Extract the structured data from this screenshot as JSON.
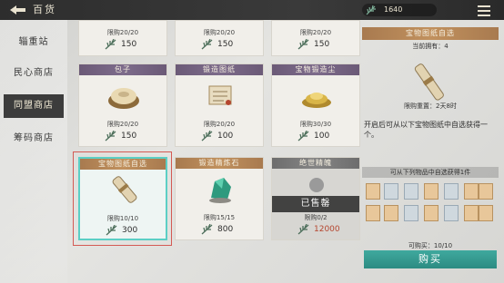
{
  "header": {
    "back_icon": "back-arrow-icon",
    "title": "百货",
    "currency_icon": "bamboo-leaf-icon",
    "currency_value": "1640",
    "menu_icon": "menu-icon"
  },
  "sidebar": {
    "items": [
      {
        "label": "辎重站",
        "active": false
      },
      {
        "label": "民心商店",
        "active": false
      },
      {
        "label": "同盟商店",
        "active": true
      },
      {
        "label": "筹码商店",
        "active": false
      }
    ]
  },
  "grid": {
    "row0": [
      {
        "limit": "限购20/20",
        "price": "150"
      },
      {
        "limit": "限购20/20",
        "price": "150"
      },
      {
        "limit": "限购20/20",
        "price": "150"
      }
    ],
    "row1": [
      {
        "name": "包子",
        "icon": "bun-icon",
        "limit": "限购20/20",
        "price": "150"
      },
      {
        "name": "锻造图纸",
        "icon": "scroll-icon",
        "limit": "限购20/20",
        "price": "100"
      },
      {
        "name": "宝物锻造尘",
        "icon": "gold-dust-icon",
        "limit": "限购30/30",
        "price": "100"
      }
    ],
    "row2": [
      {
        "name": "宝物图纸自选",
        "icon": "scroll-icon",
        "limit": "限购10/10",
        "price": "300",
        "selected": true
      },
      {
        "name": "锻造精炼石",
        "icon": "jade-stone-icon",
        "limit": "限购15/15",
        "price": "800"
      },
      {
        "name": "绝世精魄",
        "icon": "spirit-icon",
        "limit": "限购0/2",
        "price": "12000",
        "sold_label": "已售罄"
      }
    ]
  },
  "panel": {
    "title": "宝物图纸自选",
    "owned": "当前拥有：4",
    "reset": "限购重置：2天8时",
    "description": "开启后可从以下宝物图纸中自选获得一个。",
    "subheader": "可从下列物品中自选获得1件",
    "can_buy": "可购买：10/10",
    "buy_label": "购买"
  },
  "colors": {
    "accent": "#2c8b82",
    "highlight_frame": "#d45a54",
    "selected_border": "#5ccfc5"
  }
}
